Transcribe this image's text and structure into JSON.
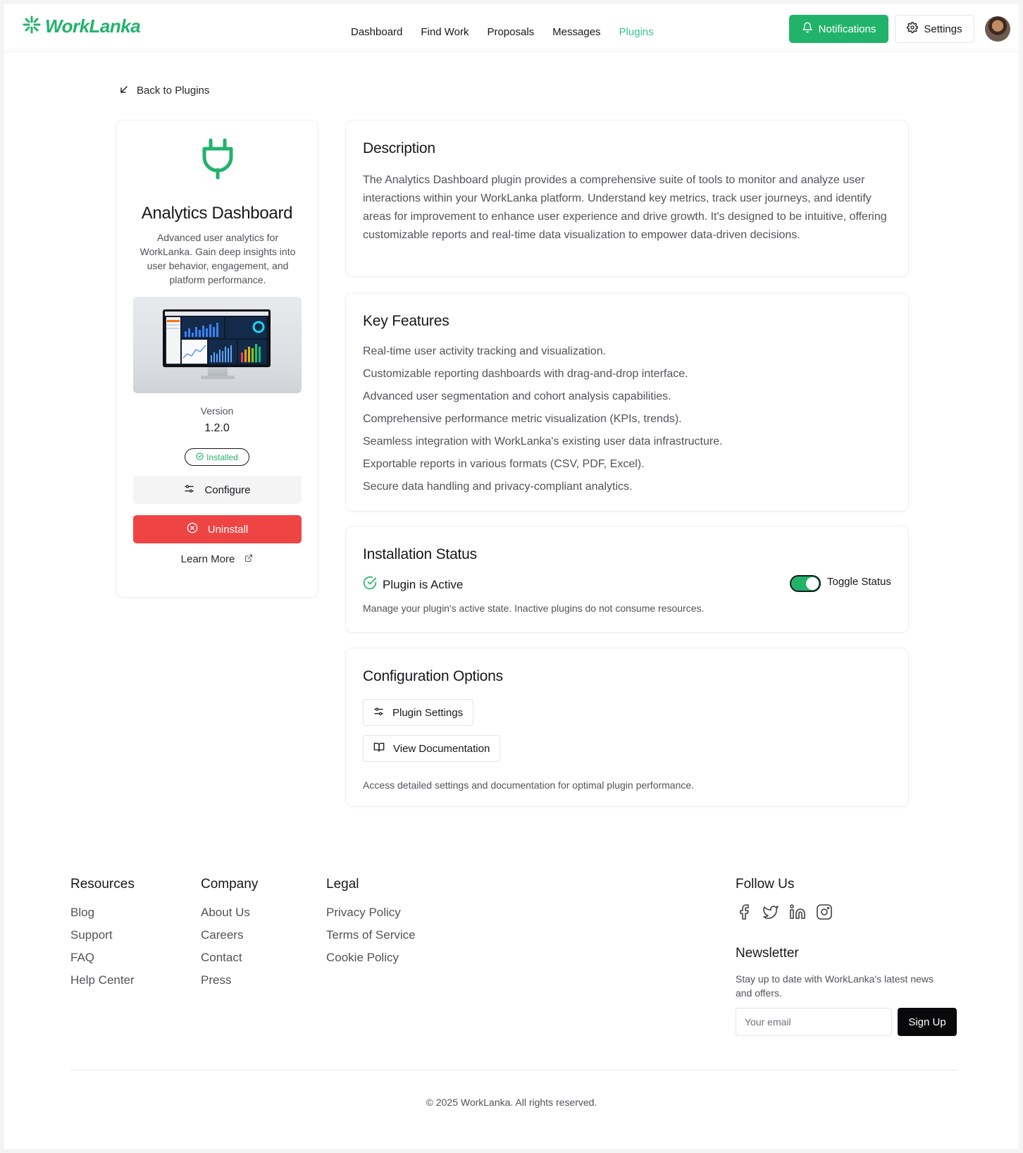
{
  "header": {
    "brand": "WorkLanka",
    "nav": [
      {
        "label": "Dashboard",
        "active": false
      },
      {
        "label": "Find Work",
        "active": false
      },
      {
        "label": "Proposals",
        "active": false
      },
      {
        "label": "Messages",
        "active": false
      },
      {
        "label": "Plugins",
        "active": true
      }
    ],
    "notifications_label": "Notifications",
    "settings_label": "Settings"
  },
  "back_label": "Back to Plugins",
  "plugin": {
    "name": "Analytics Dashboard",
    "summary": "Advanced user analytics for WorkLanka. Gain deep insights into user behavior, engagement, and platform performance.",
    "version_label": "Version",
    "version": "1.2.0",
    "status_badge": "Installed",
    "configure_label": "Configure",
    "uninstall_label": "Uninstall",
    "learn_more_label": "Learn More"
  },
  "description": {
    "title": "Description",
    "text": "The Analytics Dashboard plugin provides a comprehensive suite of tools to monitor and analyze user interactions within your WorkLanka platform. Understand key metrics, track user journeys, and identify areas for improvement to enhance user experience and drive growth. It's designed to be intuitive, offering customizable reports and real-time data visualization to empower data-driven decisions."
  },
  "features": {
    "title": "Key Features",
    "items": [
      "Real-time user activity tracking and visualization.",
      "Customizable reporting dashboards with drag-and-drop interface.",
      "Advanced user segmentation and cohort analysis capabilities.",
      "Comprehensive performance metric visualization (KPIs, trends).",
      "Seamless integration with WorkLanka's existing user data infrastructure.",
      "Exportable reports in various formats (CSV, PDF, Excel).",
      "Secure data handling and privacy-compliant analytics."
    ]
  },
  "installation": {
    "title": "Installation Status",
    "status_text": "Plugin is Active",
    "toggle_label": "Toggle Status",
    "toggle_on": true,
    "note": "Manage your plugin's active state. Inactive plugins do not consume resources."
  },
  "configuration": {
    "title": "Configuration Options",
    "plugin_settings_label": "Plugin Settings",
    "view_docs_label": "View Documentation",
    "note": "Access detailed settings and documentation for optimal plugin performance."
  },
  "footer": {
    "resources": {
      "title": "Resources",
      "links": [
        "Blog",
        "Support",
        "FAQ",
        "Help Center"
      ]
    },
    "company": {
      "title": "Company",
      "links": [
        "About Us",
        "Careers",
        "Contact",
        "Press"
      ]
    },
    "legal": {
      "title": "Legal",
      "links": [
        "Privacy Policy",
        "Terms of Service",
        "Cookie Policy"
      ]
    },
    "follow_title": "Follow Us",
    "social_icons": [
      "facebook-icon",
      "twitter-icon",
      "linkedin-icon",
      "instagram-icon"
    ],
    "newsletter_title": "Newsletter",
    "newsletter_text": "Stay up to date with WorkLanka's latest news and offers.",
    "email_placeholder": "Your email",
    "signup_label": "Sign Up",
    "copyright": "© 2025 WorkLanka. All rights reserved."
  },
  "colors": {
    "brand": "#22b36b",
    "danger": "#ef4444",
    "dark": "#09090b"
  }
}
